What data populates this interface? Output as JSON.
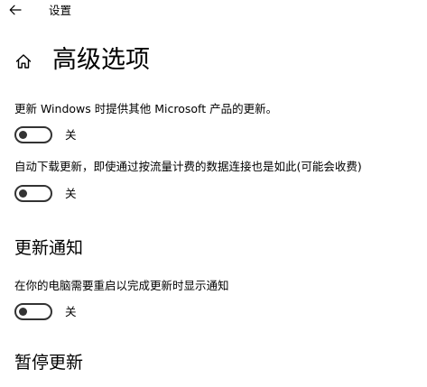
{
  "window": {
    "title": "设置"
  },
  "header": {
    "title": "高级选项"
  },
  "options": [
    {
      "label": "更新 Windows 时提供其他 Microsoft 产品的更新。",
      "state": "关",
      "on": false
    },
    {
      "label": "自动下载更新，即使通过按流量计费的数据连接也是如此(可能会收费)",
      "state": "关",
      "on": false
    }
  ],
  "notifications": {
    "heading": "更新通知",
    "label": "在你的电脑需要重启以完成更新时显示通知",
    "state": "关",
    "on": false
  },
  "pause": {
    "heading": "暂停更新"
  },
  "icons": {
    "back": "back-arrow-icon",
    "home": "home-icon"
  },
  "colors": {
    "toggle_off": "#333333",
    "background": "#ffffff",
    "text": "#000000"
  }
}
